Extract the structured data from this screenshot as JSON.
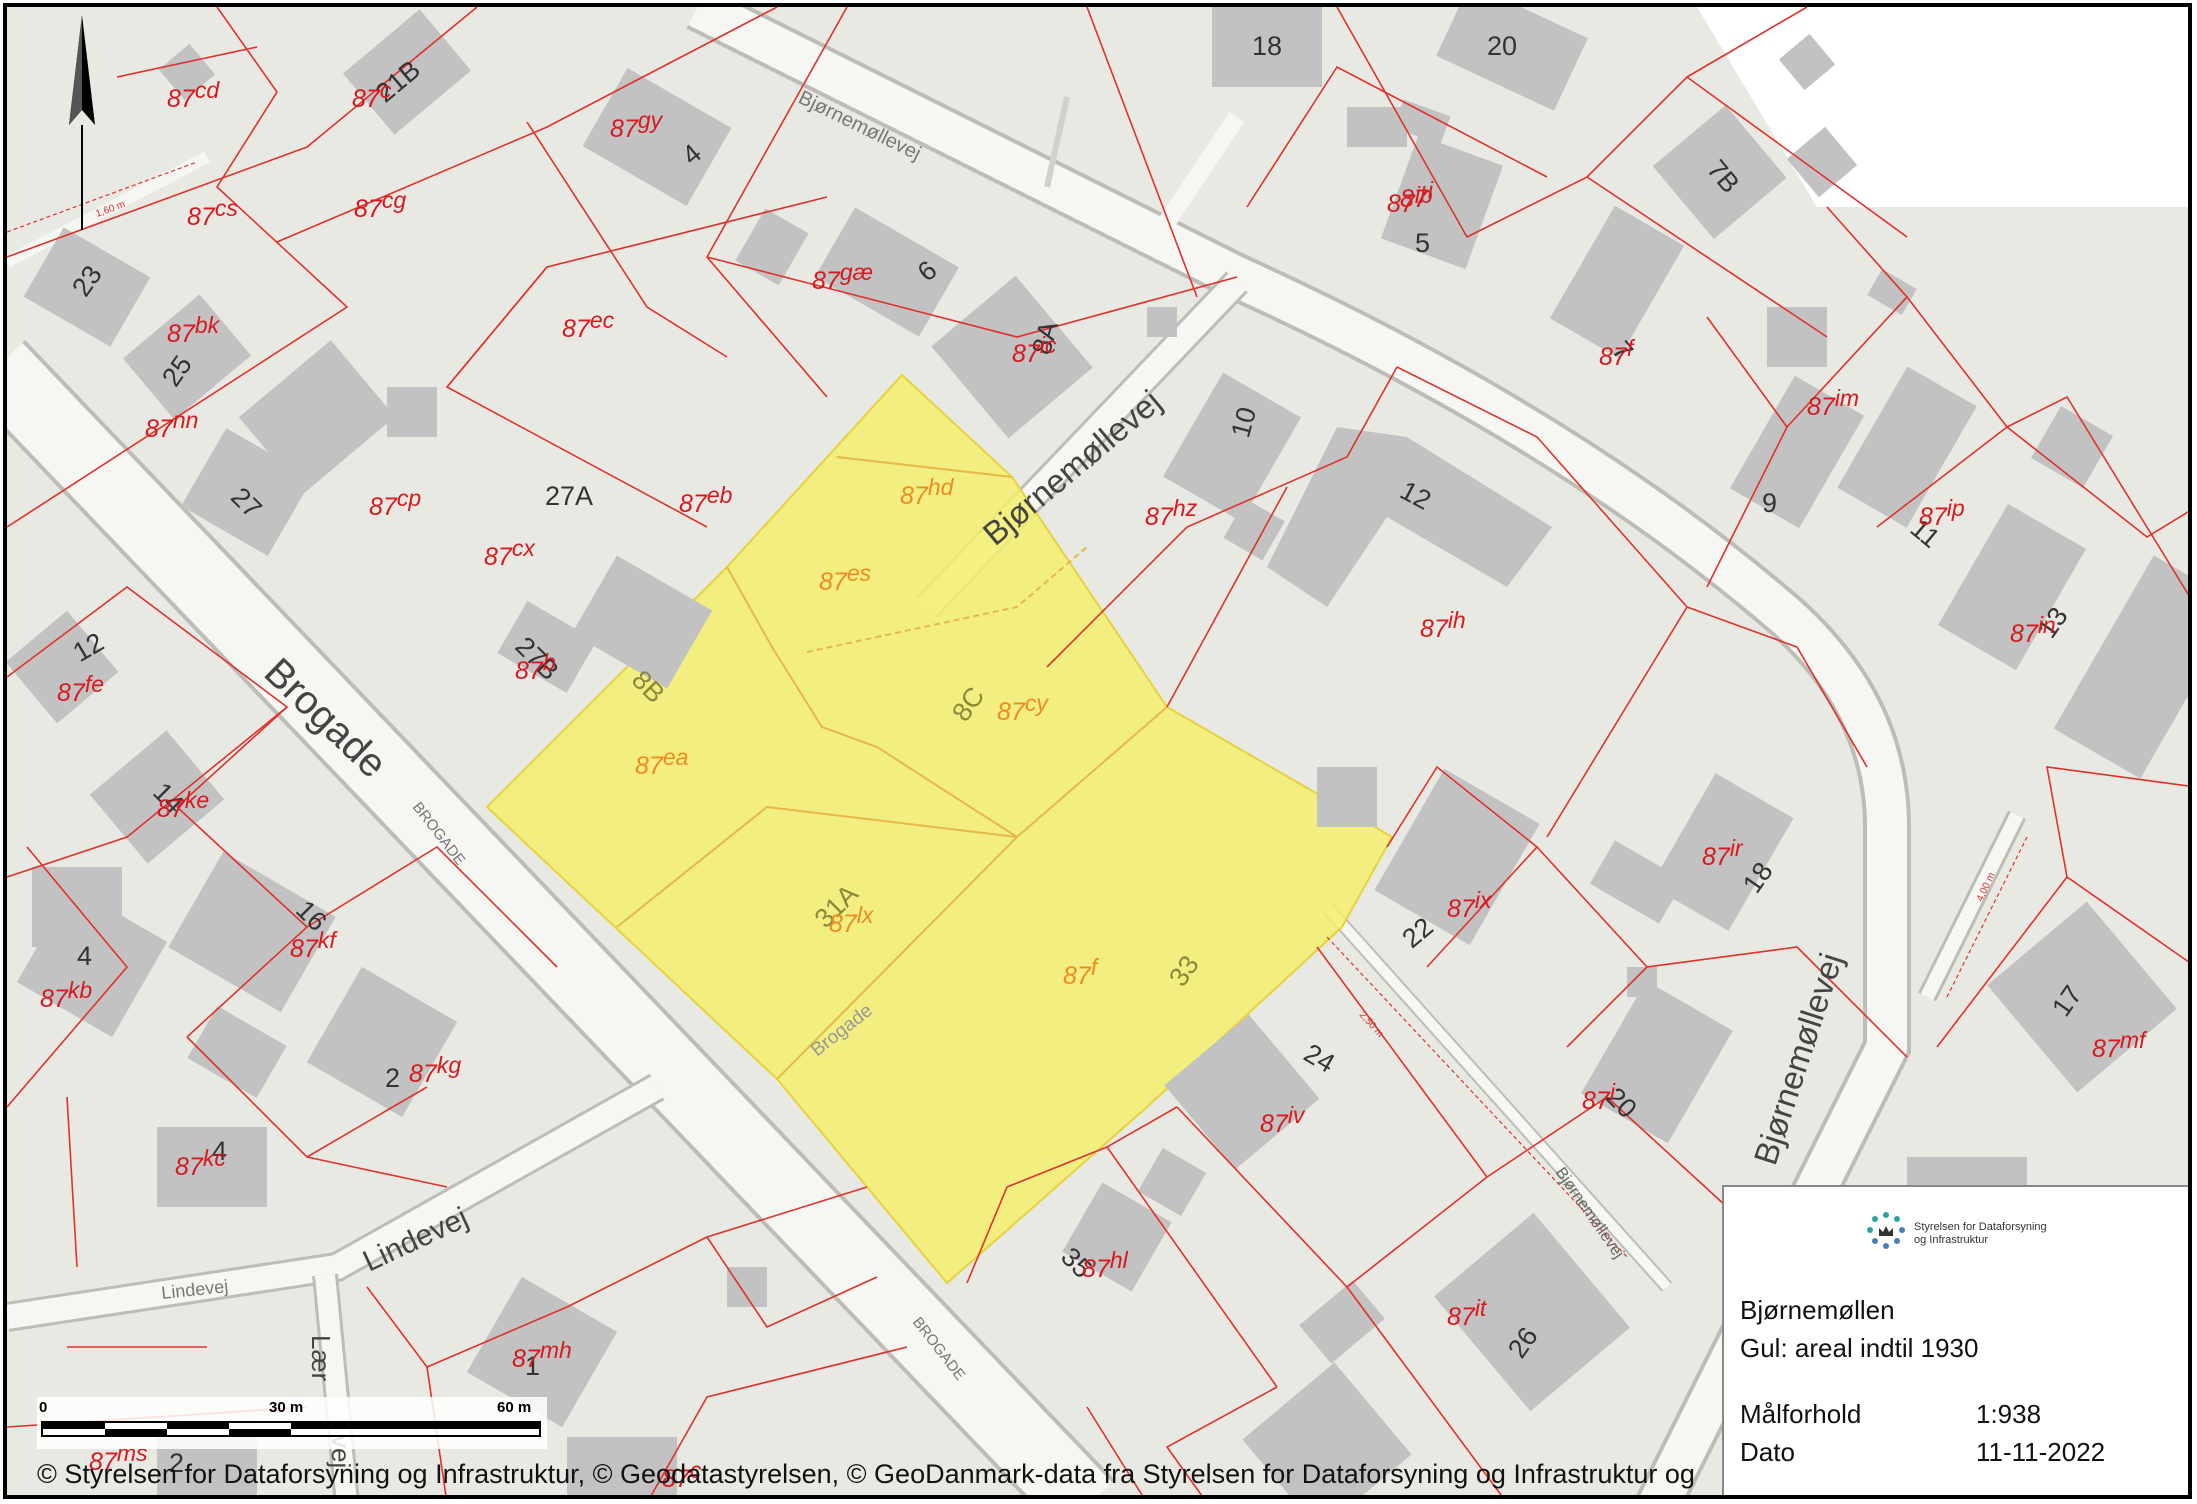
{
  "title": "Bjørnemøllen",
  "legend": {
    "agency_line1": "Styrelsen for Dataforsyning",
    "agency_line2": "og Infrastruktur",
    "place": "Bjørnemøllen",
    "note": "Gul: areal indtil 1930",
    "scale_label": "Målforhold",
    "scale_value": "1:938",
    "date_label": "Dato",
    "date_value": "11-11-2022"
  },
  "copyright": "© Styrelsen for Dataforsyning og Infrastruktur, © Geodatastyrelsen, © GeoDanmark-data fra Styrelsen for Dataforsyning og Infrastruktur og",
  "scalebar": {
    "tick0": "0",
    "tick1": "30 m",
    "tick2": "60 m"
  },
  "colors": {
    "background": "#e9e9e3",
    "building": "#c2c2c2",
    "road": "#f6f6f2",
    "road_edge": "#bdbdb8",
    "parcel_line": "#e0312b",
    "parcel_label": "#d71920",
    "highlight_fill": "#f3f06f",
    "highlight_label": "#f08a24"
  },
  "street_labels": {
    "brogade_main": "Brogade",
    "brogade_small_1": "BROGADE",
    "brogade_small_2": "BROGADE",
    "brogade_highlight": "Brogade",
    "bjornemollevej_top": "Bjørnemøllevej",
    "bjornemollevej_mid": "Bjørnemøllevej",
    "bjornemollevej_right": "Bjørnemøllevej",
    "bjornemollevej_small": "Bjørnemøllevej",
    "lindevej_main": "Lindevej",
    "lindevej_small": "Lindevej",
    "laer": "Lær",
    "laer_tail": "vej"
  },
  "dimension_labels": [
    "1,60 m",
    "2,50 m",
    "4,00 m"
  ],
  "house_numbers": [
    "18",
    "20",
    "21B",
    "4",
    "6",
    "8A",
    "10",
    "12",
    "5",
    "7B",
    "7",
    "23",
    "25",
    "27",
    "27A",
    "27B",
    "12",
    "8B",
    "8C",
    "14",
    "16",
    "4",
    "2",
    "4",
    "31A",
    "33",
    "22",
    "18",
    "20",
    "24",
    "35",
    "26",
    "1",
    "2",
    "9",
    "11",
    "13",
    "17"
  ],
  "parcels": [
    {
      "p": "87",
      "s": "cd"
    },
    {
      "p": "87",
      "s": "c"
    },
    {
      "p": "87",
      "s": "gy"
    },
    {
      "p": "87",
      "s": "cs"
    },
    {
      "p": "87",
      "s": "cg"
    },
    {
      "p": "87",
      "s": "gæ"
    },
    {
      "p": "87",
      "s": "ec"
    },
    {
      "p": "87",
      "s": "ic"
    },
    {
      "p": "87",
      "s": "bk"
    },
    {
      "p": "87",
      "s": "nn"
    },
    {
      "p": "87",
      "s": "cp"
    },
    {
      "p": "87",
      "s": "eb"
    },
    {
      "p": "87",
      "s": "cx"
    },
    {
      "p": "87",
      "s": "hd"
    },
    {
      "p": "87",
      "s": "es"
    },
    {
      "p": "87",
      "s": "hz"
    },
    {
      "p": "87",
      "s": "ib"
    },
    {
      "p": "87",
      "s": "i"
    },
    {
      "p": "87",
      "s": "f"
    },
    {
      "p": "87",
      "s": "im"
    },
    {
      "p": "87",
      "s": "ip"
    },
    {
      "p": "87",
      "s": "ih"
    },
    {
      "p": "87",
      "s": "in"
    },
    {
      "p": "87",
      "s": "fe"
    },
    {
      "p": "87",
      "s": "b"
    },
    {
      "p": "87",
      "s": "cy"
    },
    {
      "p": "87",
      "s": "ea"
    },
    {
      "p": "87",
      "s": "ke"
    },
    {
      "p": "87",
      "s": "kf"
    },
    {
      "p": "87",
      "s": "kb"
    },
    {
      "p": "87",
      "s": "kg"
    },
    {
      "p": "87",
      "s": "kc"
    },
    {
      "p": "87",
      "s": "lx"
    },
    {
      "p": "87",
      "s": "f"
    },
    {
      "p": "87",
      "s": "ix"
    },
    {
      "p": "87",
      "s": "ir"
    },
    {
      "p": "87",
      "s": "mf"
    },
    {
      "p": "87",
      "s": "iv"
    },
    {
      "p": "87",
      "s": "i"
    },
    {
      "p": "87",
      "s": "hl"
    },
    {
      "p": "87",
      "s": "it"
    },
    {
      "p": "87",
      "s": "mh"
    },
    {
      "p": "87",
      "s": "ms"
    },
    {
      "p": "87",
      "s": "c"
    }
  ]
}
